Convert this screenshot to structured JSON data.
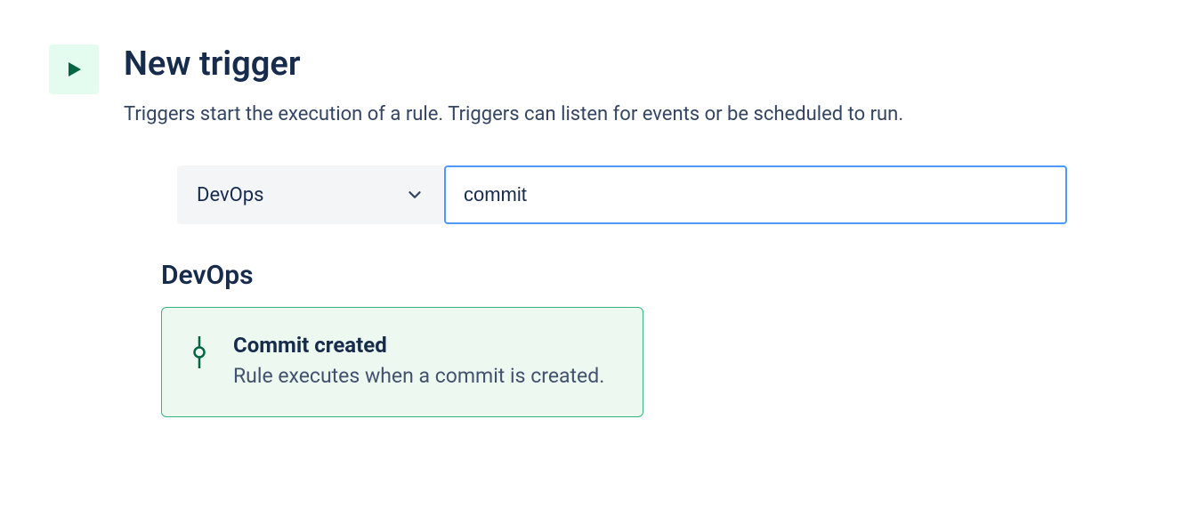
{
  "header": {
    "title": "New trigger",
    "description": "Triggers start the execution of a rule. Triggers can listen for events or be scheduled to run."
  },
  "filters": {
    "dropdown_label": "DevOps",
    "search_value": "commit"
  },
  "section": {
    "title": "DevOps"
  },
  "trigger": {
    "title": "Commit created",
    "description": "Rule executes when a commit is created."
  }
}
